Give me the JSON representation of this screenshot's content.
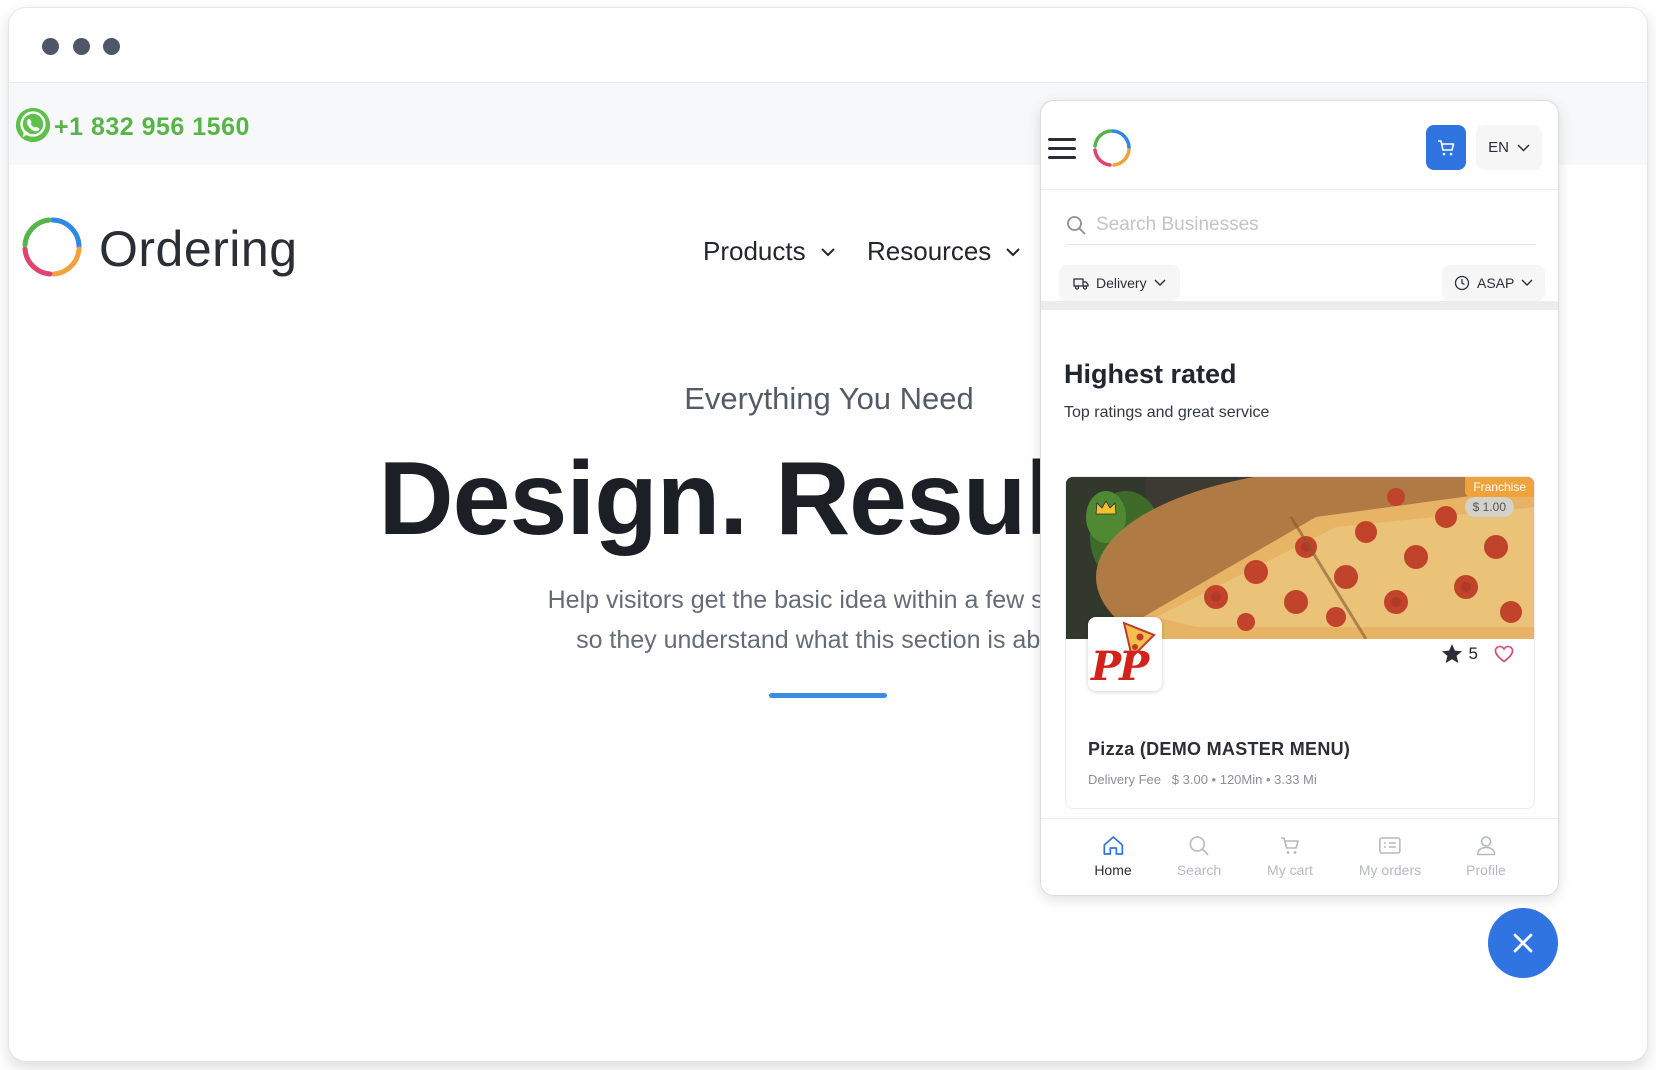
{
  "topbar": {
    "phone": "+1 832 956 1560"
  },
  "brand": {
    "name": "Ordering"
  },
  "nav": [
    {
      "label": "Products"
    },
    {
      "label": "Resources"
    }
  ],
  "hero": {
    "eyebrow": "Everything You Need",
    "headline": "Design. Results. G",
    "subline_1": "Help visitors get the basic idea within a few seconc",
    "subline_2": "so they understand what this section is about."
  },
  "app": {
    "language": "EN",
    "search": {
      "placeholder": "Search Businesses"
    },
    "order_type": "Delivery",
    "time": "ASAP",
    "section": {
      "title": "Highest rated",
      "subtitle": "Top ratings and great service"
    },
    "business": {
      "badge": "Franchise",
      "price_badge": "$ 1.00",
      "logo_text": "PP",
      "rating": "5",
      "name": "Pizza (DEMO MASTER MENU)",
      "meta": "Delivery Fee   $ 3.00 • 120Min • 3.33 Mi"
    },
    "tabs": [
      {
        "label": "Home",
        "icon": "home-icon",
        "active": true
      },
      {
        "label": "Search",
        "icon": "search-icon",
        "active": false
      },
      {
        "label": "My cart",
        "icon": "cart-icon",
        "active": false
      },
      {
        "label": "My orders",
        "icon": "orders-icon",
        "active": false
      },
      {
        "label": "Profile",
        "icon": "profile-icon",
        "active": false
      }
    ]
  },
  "colors": {
    "accent": "#2f74e0",
    "phone_green": "#57b548",
    "franchise_badge": "#f0a33c",
    "underline": "#3d8de0"
  }
}
